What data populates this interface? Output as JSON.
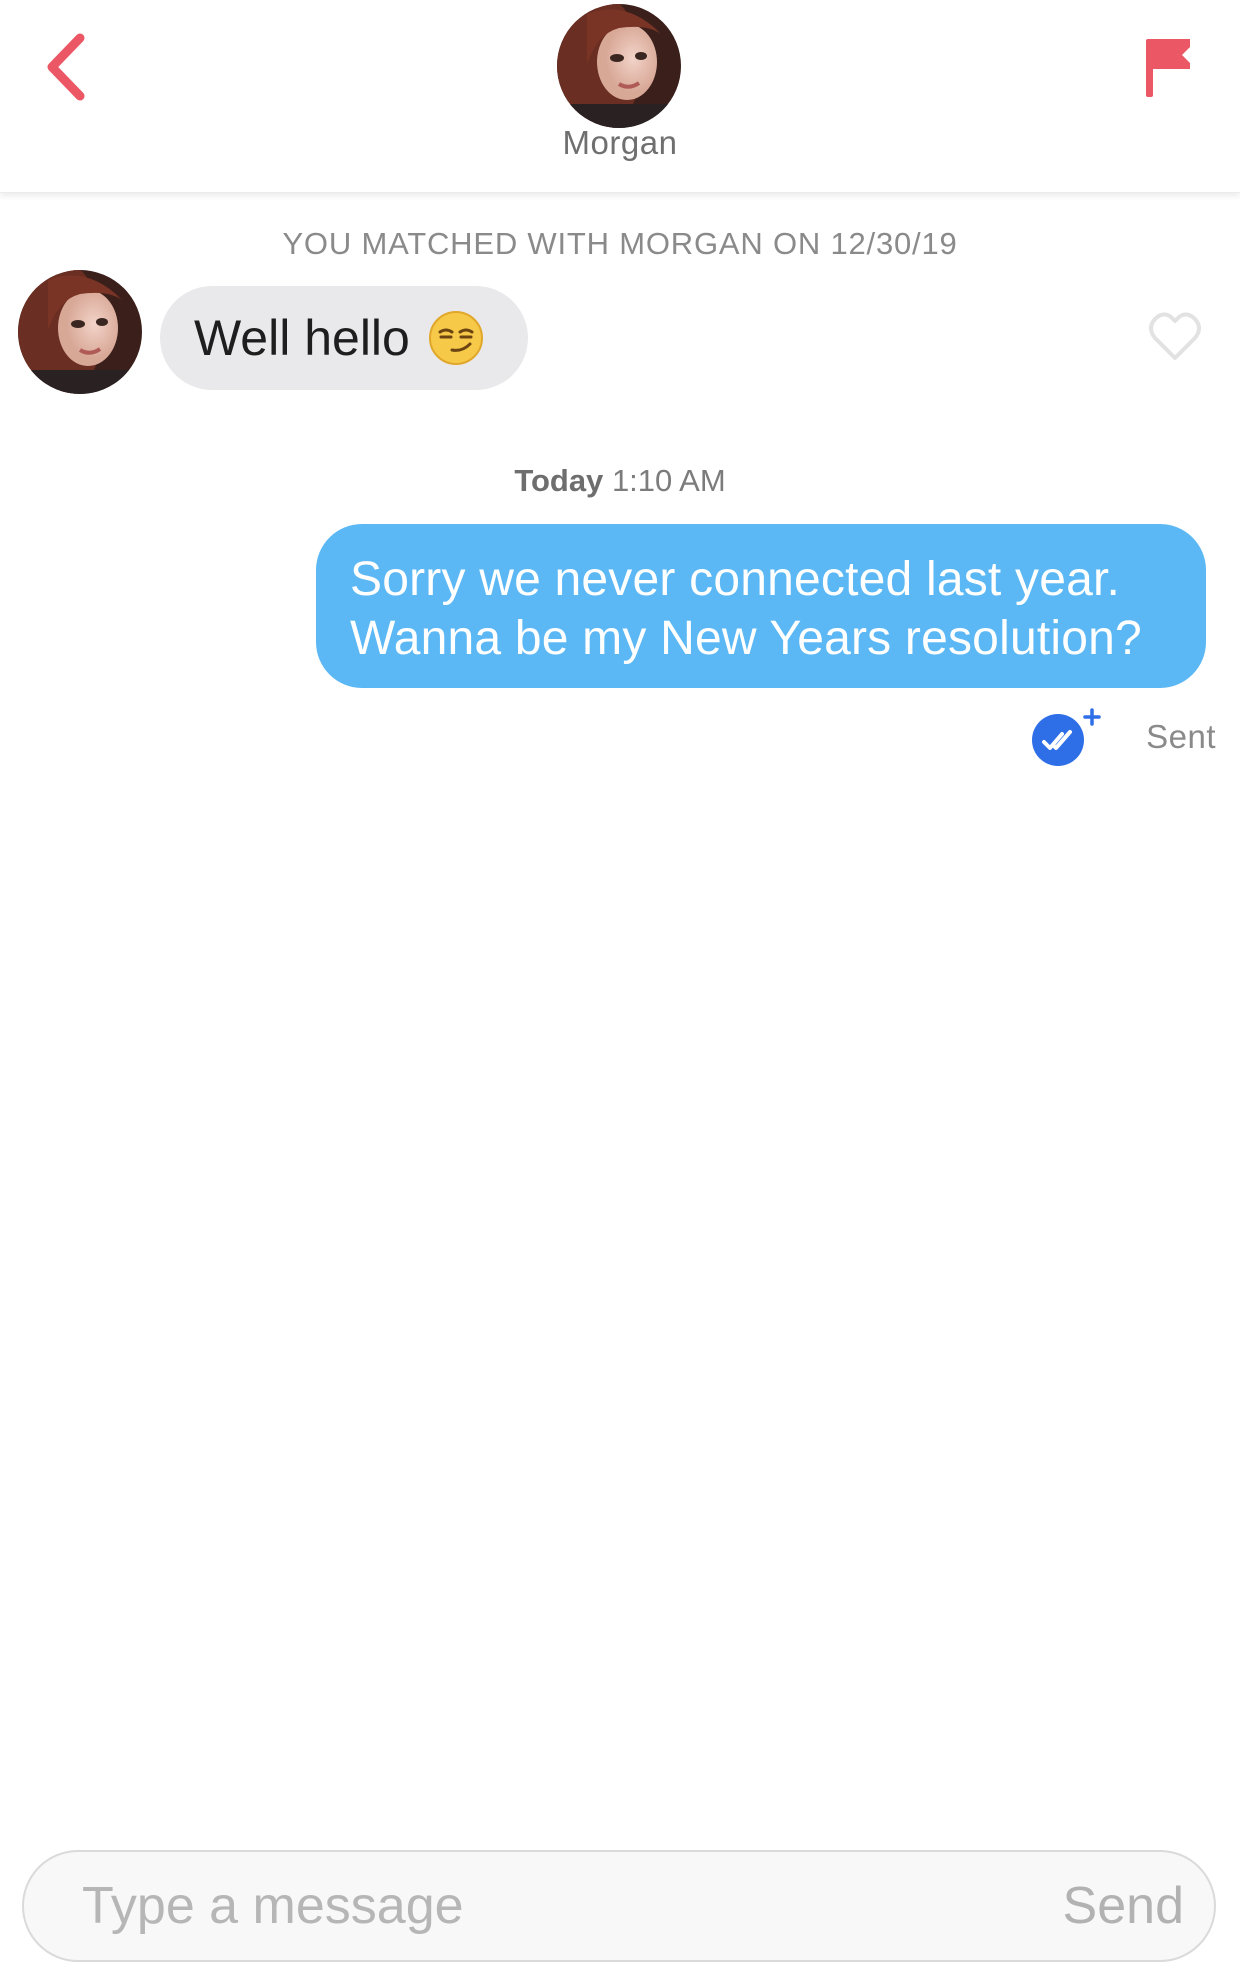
{
  "header": {
    "name": "Morgan",
    "back_icon": "chevron-left-icon",
    "report_icon": "flag-icon",
    "accent_color": "#ec5766"
  },
  "conversation": {
    "match_banner": "YOU MATCHED WITH MORGAN ON 12/30/19",
    "incoming": {
      "text": "Well hello",
      "emoji": "smirking-face-emoji",
      "like_icon": "heart-outline-icon"
    },
    "timestamp": {
      "day": "Today",
      "time": "1:10 AM"
    },
    "outgoing": {
      "line1": "Sorry we never connected last year.",
      "line2": "Wanna be my New Years resolution?",
      "bubble_color": "#5bb8f5"
    },
    "receipt": {
      "icon": "read-receipt-icon",
      "status": "Sent"
    }
  },
  "composer": {
    "placeholder": "Type a message",
    "send_label": "Send"
  }
}
